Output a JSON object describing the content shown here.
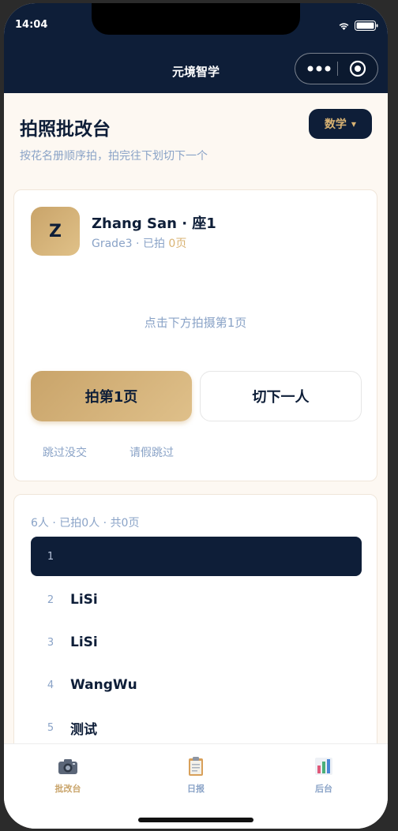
{
  "status_bar": {
    "time": "14:04"
  },
  "nav": {
    "title": "元境智学"
  },
  "header": {
    "title": "拍照批改台",
    "subtitle": "按花名册顺序拍，拍完往下划切下一个",
    "subject": "数学"
  },
  "current_student": {
    "initial": "Z",
    "name": "Zhang San",
    "seat": "座1",
    "grade": "Grade3",
    "photographed_label": "已拍",
    "photographed_count": "0页",
    "hint": "点击下方拍摄第1页",
    "capture_button": "拍第1页",
    "next_button": "切下一人",
    "skip_absent": "跳过没交",
    "skip_leave": "请假跳过"
  },
  "roster": {
    "total": "6人",
    "photographed": "已拍0人",
    "pages": "共0页",
    "rows": [
      {
        "num": "1",
        "name": ""
      },
      {
        "num": "2",
        "name": "LiSi"
      },
      {
        "num": "3",
        "name": "LiSi"
      },
      {
        "num": "4",
        "name": "WangWu"
      },
      {
        "num": "5",
        "name": "测试"
      }
    ]
  },
  "tabbar": {
    "items": [
      {
        "label": "批改台",
        "icon": "camera-icon",
        "active": true
      },
      {
        "label": "日报",
        "icon": "clipboard-icon",
        "active": false
      },
      {
        "label": "后台",
        "icon": "bar-chart-icon",
        "active": false
      }
    ]
  },
  "colors": {
    "navy": "#0e1e38",
    "gold": "#c9a46a",
    "muted_blue": "#8aa3c7",
    "background": "#fdf8f2"
  }
}
